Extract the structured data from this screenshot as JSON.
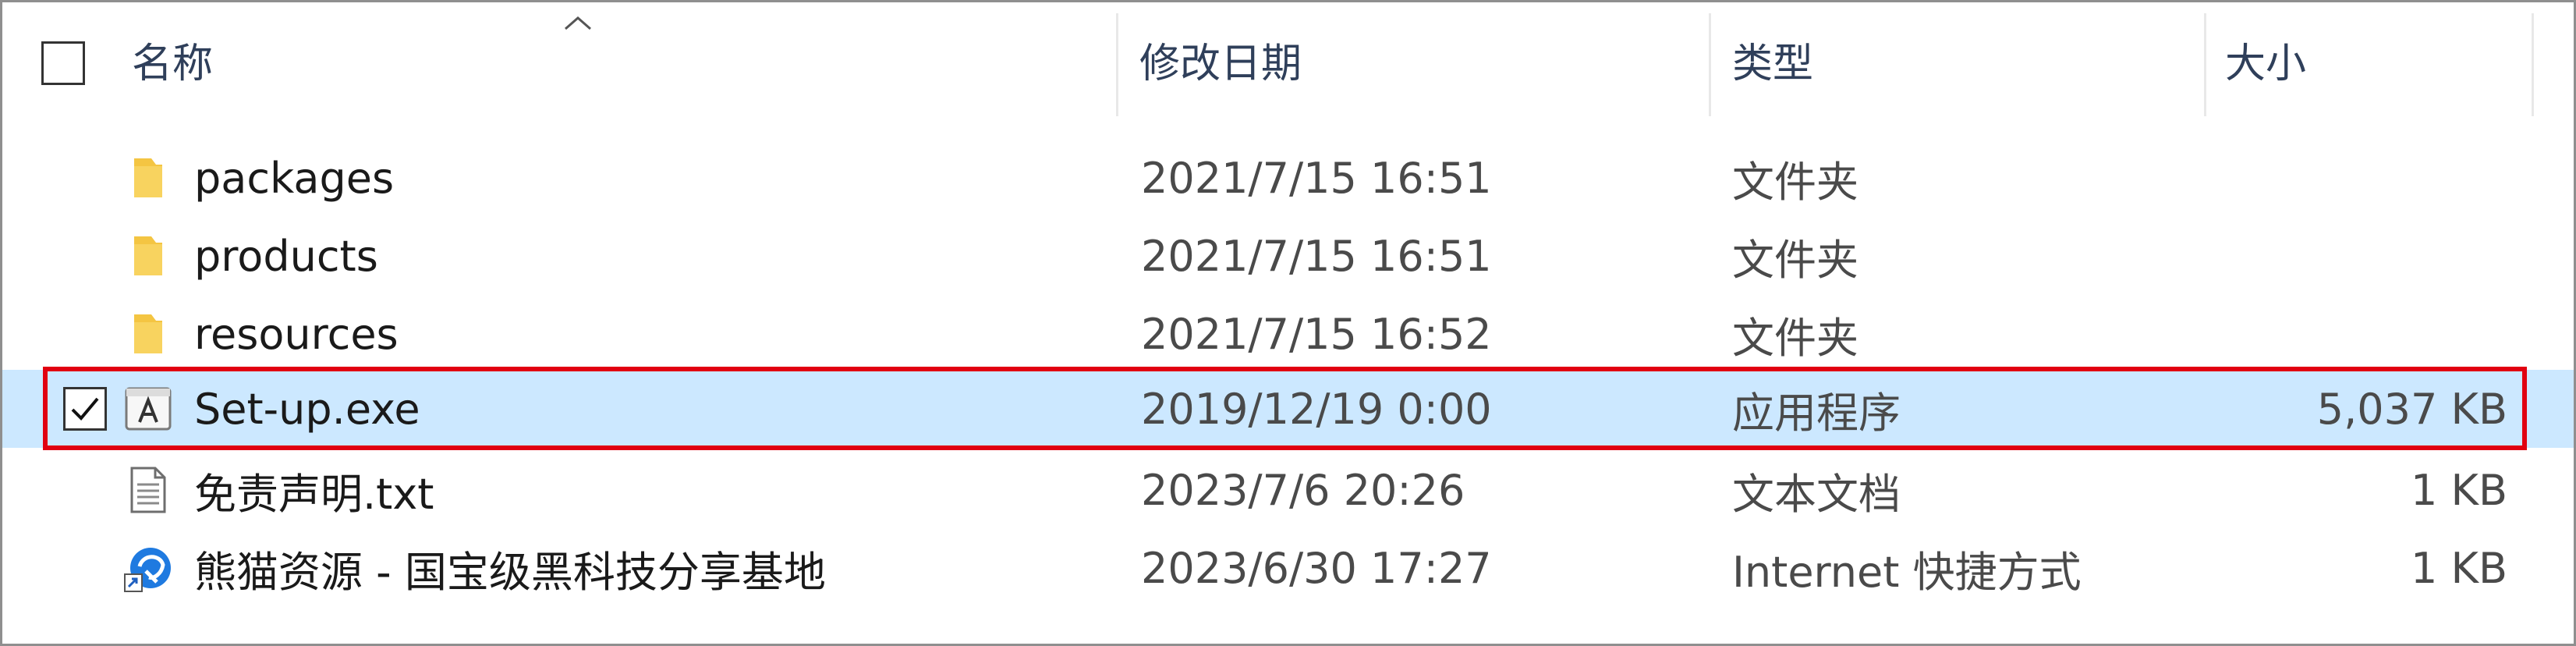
{
  "header": {
    "col_name": "名称",
    "col_date": "修改日期",
    "col_type": "类型",
    "col_size": "大小"
  },
  "files": [
    {
      "name": "packages",
      "date": "2021/7/15 16:51",
      "type": "文件夹",
      "size": "",
      "icon": "folder-icon"
    },
    {
      "name": "products",
      "date": "2021/7/15 16:51",
      "type": "文件夹",
      "size": "",
      "icon": "folder-icon"
    },
    {
      "name": "resources",
      "date": "2021/7/15 16:52",
      "type": "文件夹",
      "size": "",
      "icon": "folder-icon"
    },
    {
      "name": "Set-up.exe",
      "date": "2019/12/19 0:00",
      "type": "应用程序",
      "size": "5,037 KB",
      "icon": "adobe-installer-icon",
      "selected": true
    },
    {
      "name": "免责声明.txt",
      "date": "2023/7/6 20:26",
      "type": "文本文档",
      "size": "1 KB",
      "icon": "text-file-icon"
    },
    {
      "name": "熊猫资源 - 国宝级黑科技分享基地",
      "date": "2023/6/30 17:27",
      "type": "Internet 快捷方式",
      "size": "1 KB",
      "icon": "internet-shortcut-icon"
    }
  ],
  "colors": {
    "selection": "#cce8ff",
    "highlight_outline": "#e10010",
    "folder": "#f4c542"
  }
}
